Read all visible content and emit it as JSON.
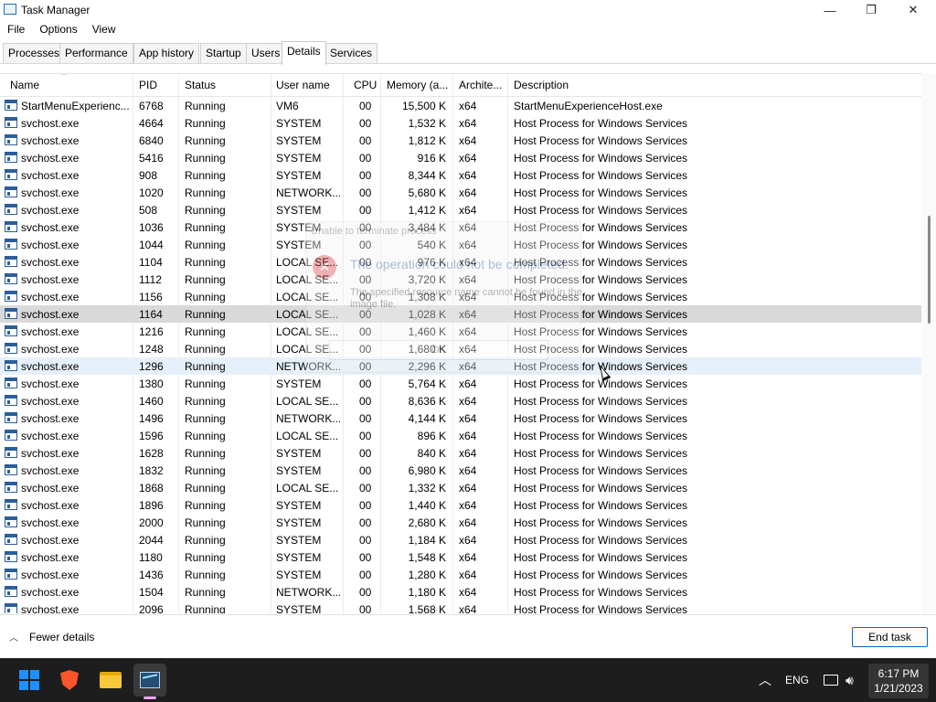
{
  "window": {
    "title": "Task Manager",
    "controls": [
      "—",
      "❐",
      "✕"
    ]
  },
  "menu": [
    "File",
    "Options",
    "View"
  ],
  "tabs": [
    "Processes",
    "Performance",
    "App history",
    "Startup",
    "Users",
    "Details",
    "Services"
  ],
  "active_tab": "Details",
  "columns": {
    "name": "Name",
    "pid": "PID",
    "status": "Status",
    "user": "User name",
    "cpu": "CPU",
    "memory": "Memory (a...",
    "arch": "Archite...",
    "desc": "Description"
  },
  "rows": [
    {
      "name": "StartMenuExperienc...",
      "pid": "6768",
      "status": "Running",
      "user": "VM6",
      "cpu": "00",
      "mem": "15,500 K",
      "arch": "x64",
      "desc": "StartMenuExperienceHost.exe"
    },
    {
      "name": "svchost.exe",
      "pid": "4664",
      "status": "Running",
      "user": "SYSTEM",
      "cpu": "00",
      "mem": "1,532 K",
      "arch": "x64",
      "desc": "Host Process for Windows Services"
    },
    {
      "name": "svchost.exe",
      "pid": "6840",
      "status": "Running",
      "user": "SYSTEM",
      "cpu": "00",
      "mem": "1,812 K",
      "arch": "x64",
      "desc": "Host Process for Windows Services"
    },
    {
      "name": "svchost.exe",
      "pid": "5416",
      "status": "Running",
      "user": "SYSTEM",
      "cpu": "00",
      "mem": "916 K",
      "arch": "x64",
      "desc": "Host Process for Windows Services"
    },
    {
      "name": "svchost.exe",
      "pid": "908",
      "status": "Running",
      "user": "SYSTEM",
      "cpu": "00",
      "mem": "8,344 K",
      "arch": "x64",
      "desc": "Host Process for Windows Services"
    },
    {
      "name": "svchost.exe",
      "pid": "1020",
      "status": "Running",
      "user": "NETWORK...",
      "cpu": "00",
      "mem": "5,680 K",
      "arch": "x64",
      "desc": "Host Process for Windows Services"
    },
    {
      "name": "svchost.exe",
      "pid": "508",
      "status": "Running",
      "user": "SYSTEM",
      "cpu": "00",
      "mem": "1,412 K",
      "arch": "x64",
      "desc": "Host Process for Windows Services"
    },
    {
      "name": "svchost.exe",
      "pid": "1036",
      "status": "Running",
      "user": "SYSTEM",
      "cpu": "00",
      "mem": "3,484 K",
      "arch": "x64",
      "desc": "Host Process for Windows Services"
    },
    {
      "name": "svchost.exe",
      "pid": "1044",
      "status": "Running",
      "user": "SYSTEM",
      "cpu": "00",
      "mem": "540 K",
      "arch": "x64",
      "desc": "Host Process for Windows Services"
    },
    {
      "name": "svchost.exe",
      "pid": "1104",
      "status": "Running",
      "user": "LOCAL SE...",
      "cpu": "00",
      "mem": "976 K",
      "arch": "x64",
      "desc": "Host Process for Windows Services"
    },
    {
      "name": "svchost.exe",
      "pid": "1112",
      "status": "Running",
      "user": "LOCAL SE...",
      "cpu": "00",
      "mem": "3,720 K",
      "arch": "x64",
      "desc": "Host Process for Windows Services"
    },
    {
      "name": "svchost.exe",
      "pid": "1156",
      "status": "Running",
      "user": "LOCAL SE...",
      "cpu": "00",
      "mem": "1,308 K",
      "arch": "x64",
      "desc": "Host Process for Windows Services"
    },
    {
      "name": "svchost.exe",
      "pid": "1164",
      "status": "Running",
      "user": "LOCAL SE...",
      "cpu": "00",
      "mem": "1,028 K",
      "arch": "x64",
      "desc": "Host Process for Windows Services",
      "highlight": "grey"
    },
    {
      "name": "svchost.exe",
      "pid": "1216",
      "status": "Running",
      "user": "LOCAL SE...",
      "cpu": "00",
      "mem": "1,460 K",
      "arch": "x64",
      "desc": "Host Process for Windows Services"
    },
    {
      "name": "svchost.exe",
      "pid": "1248",
      "status": "Running",
      "user": "LOCAL SE...",
      "cpu": "00",
      "mem": "1,680 K",
      "arch": "x64",
      "desc": "Host Process for Windows Services"
    },
    {
      "name": "svchost.exe",
      "pid": "1296",
      "status": "Running",
      "user": "NETWORK...",
      "cpu": "00",
      "mem": "2,296 K",
      "arch": "x64",
      "desc": "Host Process for Windows Services",
      "highlight": "blue"
    },
    {
      "name": "svchost.exe",
      "pid": "1380",
      "status": "Running",
      "user": "SYSTEM",
      "cpu": "00",
      "mem": "5,764 K",
      "arch": "x64",
      "desc": "Host Process for Windows Services"
    },
    {
      "name": "svchost.exe",
      "pid": "1460",
      "status": "Running",
      "user": "LOCAL SE...",
      "cpu": "00",
      "mem": "8,636 K",
      "arch": "x64",
      "desc": "Host Process for Windows Services"
    },
    {
      "name": "svchost.exe",
      "pid": "1496",
      "status": "Running",
      "user": "NETWORK...",
      "cpu": "00",
      "mem": "4,144 K",
      "arch": "x64",
      "desc": "Host Process for Windows Services"
    },
    {
      "name": "svchost.exe",
      "pid": "1596",
      "status": "Running",
      "user": "LOCAL SE...",
      "cpu": "00",
      "mem": "896 K",
      "arch": "x64",
      "desc": "Host Process for Windows Services"
    },
    {
      "name": "svchost.exe",
      "pid": "1628",
      "status": "Running",
      "user": "SYSTEM",
      "cpu": "00",
      "mem": "840 K",
      "arch": "x64",
      "desc": "Host Process for Windows Services"
    },
    {
      "name": "svchost.exe",
      "pid": "1832",
      "status": "Running",
      "user": "SYSTEM",
      "cpu": "00",
      "mem": "6,980 K",
      "arch": "x64",
      "desc": "Host Process for Windows Services"
    },
    {
      "name": "svchost.exe",
      "pid": "1868",
      "status": "Running",
      "user": "LOCAL SE...",
      "cpu": "00",
      "mem": "1,332 K",
      "arch": "x64",
      "desc": "Host Process for Windows Services"
    },
    {
      "name": "svchost.exe",
      "pid": "1896",
      "status": "Running",
      "user": "SYSTEM",
      "cpu": "00",
      "mem": "1,440 K",
      "arch": "x64",
      "desc": "Host Process for Windows Services"
    },
    {
      "name": "svchost.exe",
      "pid": "2000",
      "status": "Running",
      "user": "SYSTEM",
      "cpu": "00",
      "mem": "2,680 K",
      "arch": "x64",
      "desc": "Host Process for Windows Services"
    },
    {
      "name": "svchost.exe",
      "pid": "2044",
      "status": "Running",
      "user": "SYSTEM",
      "cpu": "00",
      "mem": "1,184 K",
      "arch": "x64",
      "desc": "Host Process for Windows Services"
    },
    {
      "name": "svchost.exe",
      "pid": "1180",
      "status": "Running",
      "user": "SYSTEM",
      "cpu": "00",
      "mem": "1,548 K",
      "arch": "x64",
      "desc": "Host Process for Windows Services"
    },
    {
      "name": "svchost.exe",
      "pid": "1436",
      "status": "Running",
      "user": "SYSTEM",
      "cpu": "00",
      "mem": "1,280 K",
      "arch": "x64",
      "desc": "Host Process for Windows Services"
    },
    {
      "name": "svchost.exe",
      "pid": "1504",
      "status": "Running",
      "user": "NETWORK...",
      "cpu": "00",
      "mem": "1,180 K",
      "arch": "x64",
      "desc": "Host Process for Windows Services"
    },
    {
      "name": "svchost.exe",
      "pid": "2096",
      "status": "Running",
      "user": "SYSTEM",
      "cpu": "00",
      "mem": "1,568 K",
      "arch": "x64",
      "desc": "Host Process for Windows Services"
    }
  ],
  "ghost_dialog": {
    "title": "Unable to terminate process",
    "icon": "error-icon",
    "main": "The operation could not be completed.",
    "detail": "The specified resource name cannot be found in the image file.",
    "ok": "OK"
  },
  "footer": {
    "fewer_details": "Fewer details",
    "end_task": "End task"
  },
  "taskbar": {
    "apps": [
      "start-icon",
      "brave-browser-icon",
      "file-explorer-icon",
      "task-manager-icon"
    ],
    "language": "ENG",
    "time": "6:17 PM",
    "date": "1/21/2023"
  },
  "colors": {
    "accent": "#0067c0",
    "selected_row_grey": "#d9d9d9",
    "selected_row_blue": "#e6f0fb",
    "taskbar": "#1d1d1d",
    "error_red": "#d13438"
  }
}
